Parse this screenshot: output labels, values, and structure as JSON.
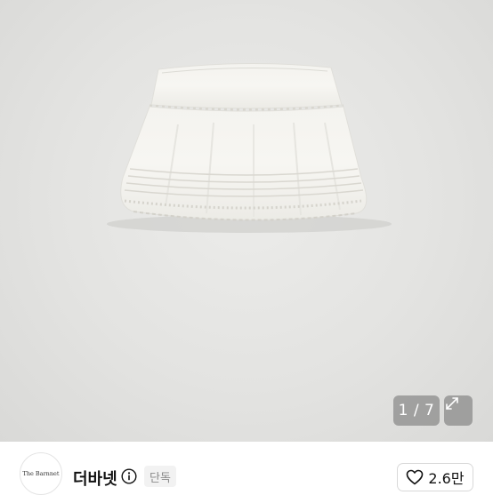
{
  "gallery": {
    "current": 1,
    "total": 7,
    "counter_text": "1 / 7",
    "expand_icon": "expand-icon",
    "image_subject": "white-tiered-lace-mini-skirt-photo"
  },
  "seller": {
    "logo_text": "The Barnnet",
    "name": "더바넷",
    "info_icon": "info-icon",
    "badge": "단독"
  },
  "like": {
    "icon": "heart-outline-icon",
    "count": "2.6만"
  },
  "colors": {
    "photo_background": "#e3e3e1",
    "badge_overlay": "#6e6e6e",
    "text_primary": "#111111",
    "badge_bg": "#f2f2f2",
    "badge_text": "#8a8a8a"
  }
}
